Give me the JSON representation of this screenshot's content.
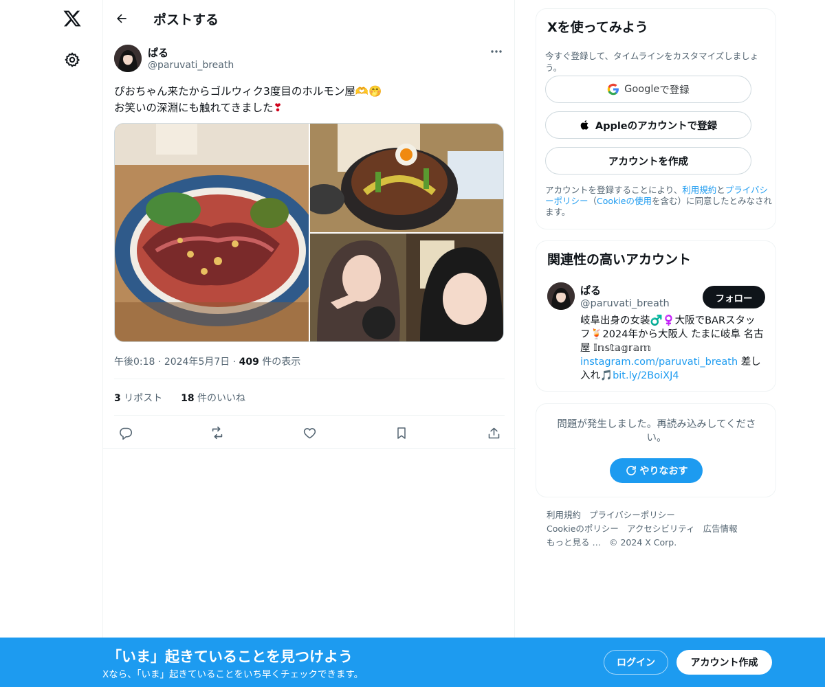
{
  "nav": {
    "logo_icon": "x-logo-icon",
    "settings_icon": "gear-icon"
  },
  "header": {
    "title": "ポストする",
    "back_icon": "arrow-left-icon"
  },
  "tweet": {
    "author_name": "ぱる",
    "author_handle": "@paruvati_breath",
    "text_line1": "ぴおちゃん来たからゴルウィク3度目のホルモン屋🫶🤭",
    "text_line2_prefix": "お笑いの深淵にも触れてきました",
    "text_line2_emoji": "❣",
    "time": "午後0:18",
    "date": "2024年5月7日",
    "views_count": "409",
    "views_label": "件の表示",
    "reposts_count": "3",
    "reposts_label": "リポスト",
    "likes_count": "18",
    "likes_label": "件のいいね",
    "sep": "·"
  },
  "signup": {
    "title": "Xを使ってみよう",
    "description": "今すぐ登録して、タイムラインをカスタマイズしましょう。",
    "google_brand": "Google",
    "google_suffix": " で登録",
    "apple_label": "Appleのアカウントで登録",
    "create_label": "アカウントを作成",
    "terms_1": "アカウントを登録することにより、",
    "terms_link1": "利用規約",
    "terms_2": "と",
    "terms_link2": "プライバシーポリシー",
    "terms_3": "（",
    "terms_link3": "Cookieの使用",
    "terms_4": "を含む）に同意したとみなされます。"
  },
  "related": {
    "title": "関連性の高いアカウント",
    "name": "ぱる",
    "handle": "@paruvati_breath",
    "follow_label": "フォロー",
    "bio_text1": "岐阜出身の女装♂️♀️大阪でBARスタッフ🍹2024年から大阪人 たまに岐阜 名古屋 𝕀𝕟𝕤𝕥𝕒𝕘𝕣𝕒𝕞",
    "bio_link1": "instagram.com/paruvati_breath",
    "bio_text2": " 差し入れ🎵",
    "bio_link2": "bit.ly/2BoiXJ4"
  },
  "error": {
    "text": "問題が発生しました。再読み込みしてください。",
    "retry_label": "やりなおす"
  },
  "footer": {
    "links": [
      "利用規約",
      "プライバシーポリシー",
      "Cookieのポリシー",
      "アクセシビリティ",
      "広告情報",
      "もっと見る …",
      "© 2024 X Corp."
    ]
  },
  "bottombar": {
    "title": "「いま」起きていることを見つけよう",
    "subtitle": "Xなら、「いま」起きていることをいち早くチェックできます。",
    "login_label": "ログイン",
    "create_label": "アカウント作成"
  },
  "colors": {
    "accent": "#1d9bf0",
    "text": "#0f1419",
    "muted": "#536471"
  }
}
